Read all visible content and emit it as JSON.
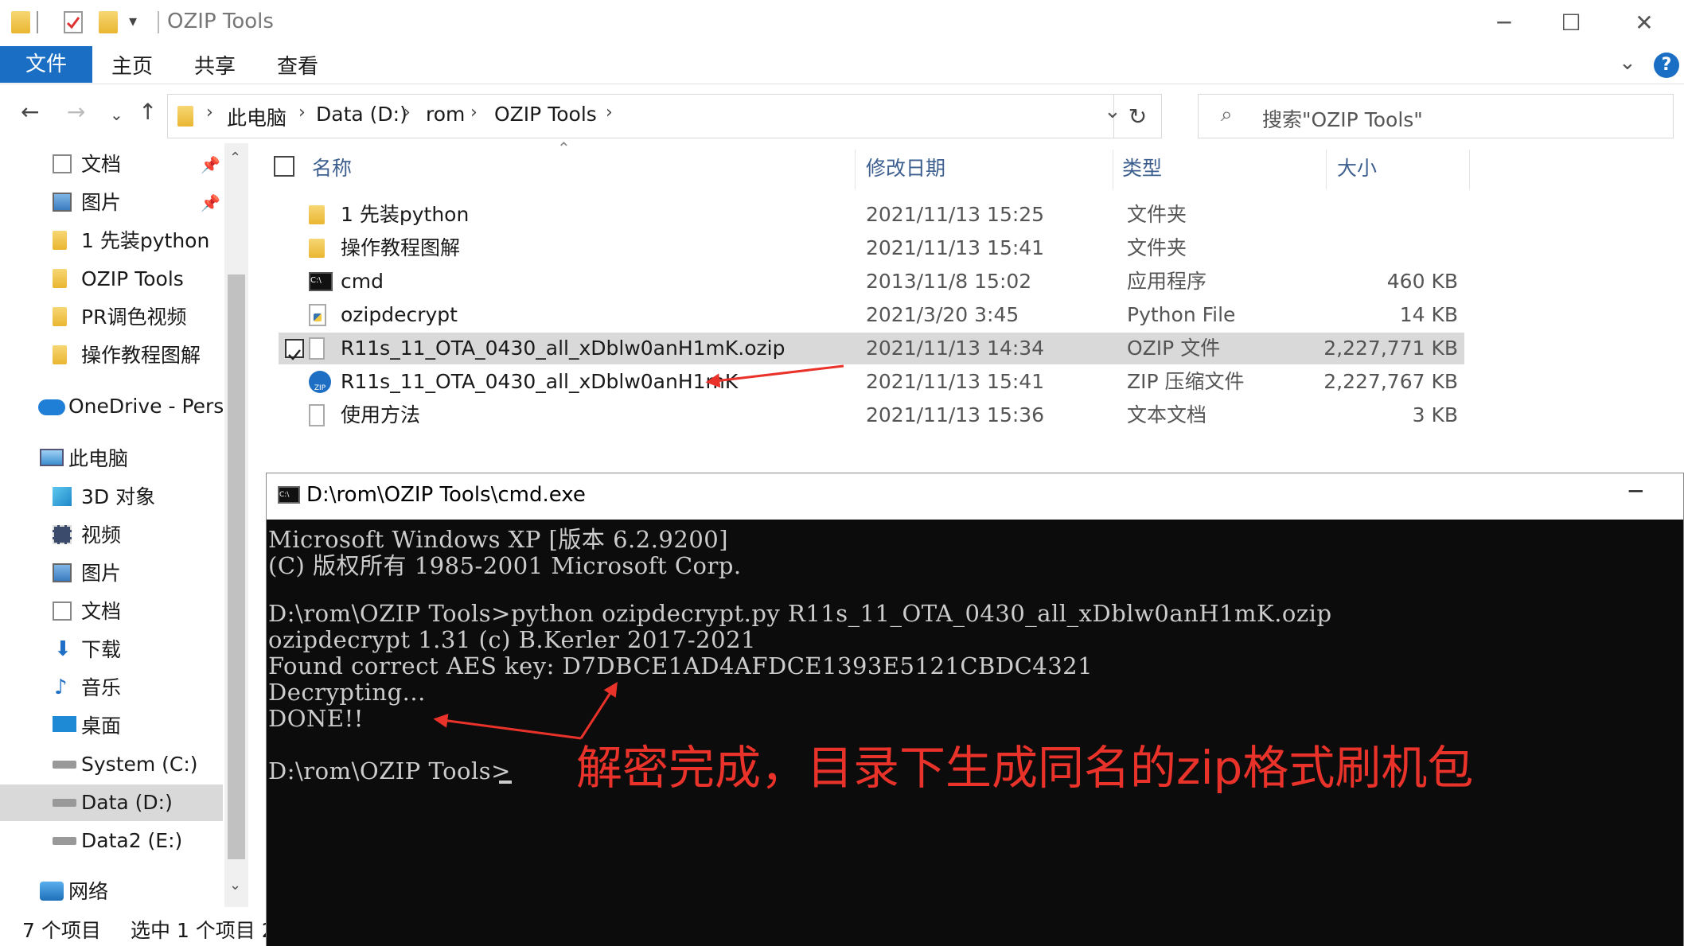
{
  "window": {
    "title": "OZIP Tools"
  },
  "ribbon": {
    "tabs": [
      "文件",
      "主页",
      "共享",
      "查看"
    ]
  },
  "address": {
    "crumbs": [
      "此电脑",
      "Data (D:)",
      "rom",
      "OZIP Tools"
    ],
    "search_placeholder": "搜索\"OZIP Tools\""
  },
  "sidebar": {
    "items": [
      {
        "label": "文档",
        "icon": "document-icon"
      },
      {
        "label": "图片",
        "icon": "picture-icon"
      },
      {
        "label": "1 先装python",
        "icon": "folder-icon"
      },
      {
        "label": "OZIP Tools",
        "icon": "folder-icon"
      },
      {
        "label": "PR调色视频",
        "icon": "folder-icon"
      },
      {
        "label": "操作教程图解",
        "icon": "folder-icon"
      },
      {
        "label": "OneDrive - Persc",
        "icon": "onedrive-icon"
      },
      {
        "label": "此电脑",
        "icon": "computer-icon"
      },
      {
        "label": "3D 对象",
        "icon": "cube-icon"
      },
      {
        "label": "视频",
        "icon": "video-icon"
      },
      {
        "label": "图片",
        "icon": "picture-icon"
      },
      {
        "label": "文档",
        "icon": "document-icon"
      },
      {
        "label": "下载",
        "icon": "download-icon"
      },
      {
        "label": "音乐",
        "icon": "music-icon"
      },
      {
        "label": "桌面",
        "icon": "desktop-icon"
      },
      {
        "label": "System (C:)",
        "icon": "drive-icon"
      },
      {
        "label": "Data (D:)",
        "icon": "drive-icon"
      },
      {
        "label": "Data2 (E:)",
        "icon": "drive-icon"
      },
      {
        "label": "网络",
        "icon": "network-icon"
      }
    ]
  },
  "filelist": {
    "columns": [
      "名称",
      "修改日期",
      "类型",
      "大小"
    ],
    "rows": [
      {
        "name": "1 先装python",
        "date": "2021/11/13 15:25",
        "type": "文件夹",
        "size": ""
      },
      {
        "name": "操作教程图解",
        "date": "2021/11/13 15:41",
        "type": "文件夹",
        "size": ""
      },
      {
        "name": "cmd",
        "date": "2013/11/8 15:02",
        "type": "应用程序",
        "size": "460 KB"
      },
      {
        "name": "ozipdecrypt",
        "date": "2021/3/20 3:45",
        "type": "Python File",
        "size": "14 KB"
      },
      {
        "name": "R11s_11_OTA_0430_all_xDblw0anH1mK.ozip",
        "date": "2021/11/13 14:34",
        "type": "OZIP 文件",
        "size": "2,227,771 KB"
      },
      {
        "name": "R11s_11_OTA_0430_all_xDblw0anH1mK",
        "date": "2021/11/13 15:41",
        "type": "ZIP 压缩文件",
        "size": "2,227,767 KB"
      },
      {
        "name": "使用方法",
        "date": "2021/11/13 15:36",
        "type": "文本文档",
        "size": "3 KB"
      }
    ]
  },
  "status": {
    "count": "7 个项目",
    "selected": "选中 1 个项目 2"
  },
  "cmd": {
    "title": "D:\\rom\\OZIP Tools\\cmd.exe",
    "lines": [
      "Microsoft Windows XP [版本 6.2.9200]",
      "(C) 版权所有 1985-2001 Microsoft Corp.",
      "",
      "D:\\rom\\OZIP Tools>python ozipdecrypt.py R11s_11_OTA_0430_all_xDblw0anH1mK.ozip",
      "ozipdecrypt 1.31 (c) B.Kerler 2017-2021",
      "Found correct AES key: D7DBCE1AD4AFDCE1393E5121CBDC4321",
      "Decrypting...",
      "DONE!!",
      "",
      "D:\\rom\\OZIP Tools>"
    ]
  },
  "annotation": {
    "text": "解密完成，目录下生成同名的zip格式刷机包",
    "color": "#e8322a"
  },
  "colors": {
    "accent": "#1a6fc4",
    "selection": "#d9d9d9"
  }
}
